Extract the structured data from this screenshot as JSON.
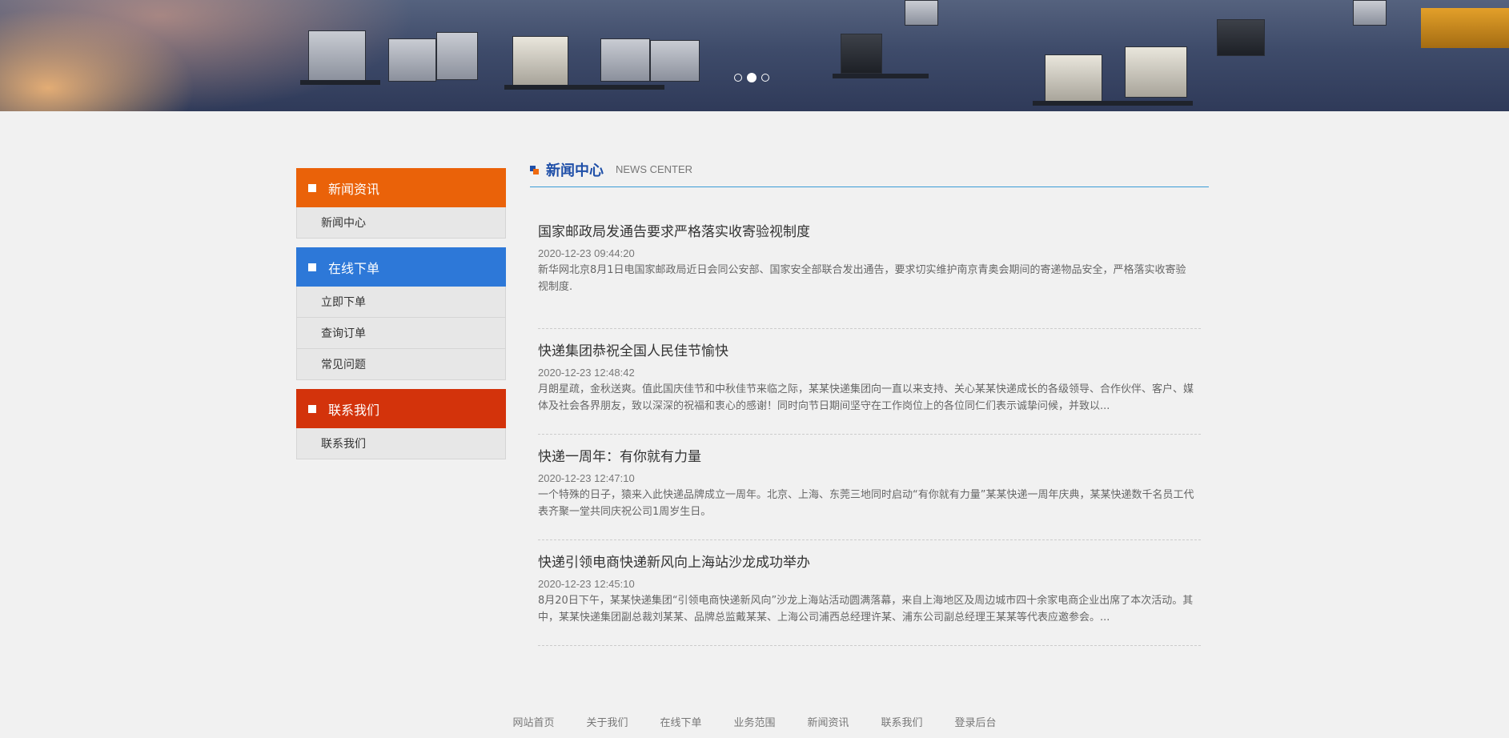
{
  "colors": {
    "orange": "#ea6209",
    "blue": "#2d78d8",
    "red": "#d3330b",
    "title_blue": "#1f4fa8",
    "divider_blue": "#3a9bd6"
  },
  "banner": {
    "slide_count": 3,
    "active_slide": 2
  },
  "sidebar": {
    "groups": [
      {
        "title": "新闻资讯",
        "color": "#ea6209",
        "items": [
          "新闻中心"
        ]
      },
      {
        "title": "在线下单",
        "color": "#2d78d8",
        "items": [
          "立即下单",
          "查询订单",
          "常见问题"
        ]
      },
      {
        "title": "联系我们",
        "color": "#d3330b",
        "items": [
          "联系我们"
        ]
      }
    ]
  },
  "section": {
    "title": "新闻中心",
    "subtitle": "NEWS CENTER"
  },
  "news": [
    {
      "title": "国家邮政局发通告要求严格落实收寄验视制度",
      "time": "2020-12-23 09:44:20",
      "desc": "新华网北京8月1日电国家邮政局近日会同公安部、国家安全部联合发出通告，要求切实维护南京青奥会期间的寄递物品安全，严格落实收寄验视制度."
    },
    {
      "title": "快递集团恭祝全国人民佳节愉快",
      "time": "2020-12-23 12:48:42",
      "desc": "月朗星疏，金秋送爽。值此国庆佳节和中秋佳节来临之际，某某快递集团向一直以来支持、关心某某快递成长的各级领导、合作伙伴、客户、媒体及社会各界朋友，致以深深的祝福和衷心的感谢！同时向节日期间坚守在工作岗位上的各位同仁们表示诚挚问候，并致以..."
    },
    {
      "title": "快递一周年：有你就有力量",
      "time": "2020-12-23 12:47:10",
      "desc": "一个特殊的日子，猿来入此快递品牌成立一周年。北京、上海、东莞三地同时启动“有你就有力量”某某快递一周年庆典，某某快递数千名员工代表齐聚一堂共同庆祝公司1周岁生日。"
    },
    {
      "title": "快递引领电商快递新风向上海站沙龙成功举办",
      "time": "2020-12-23 12:45:10",
      "desc": "8月20日下午，某某快递集团“引领电商快递新风向”沙龙上海站活动圆满落幕，来自上海地区及周边城市四十余家电商企业出席了本次活动。其中，某某快递集团副总裁刘某某、品牌总监戴某某、上海公司浦西总经理许某、浦东公司副总经理王某某等代表应邀参会。..."
    }
  ],
  "footer": {
    "links": [
      "网站首页",
      "关于我们",
      "在线下单",
      "业务范围",
      "新闻资讯",
      "联系我们",
      "登录后台"
    ]
  }
}
